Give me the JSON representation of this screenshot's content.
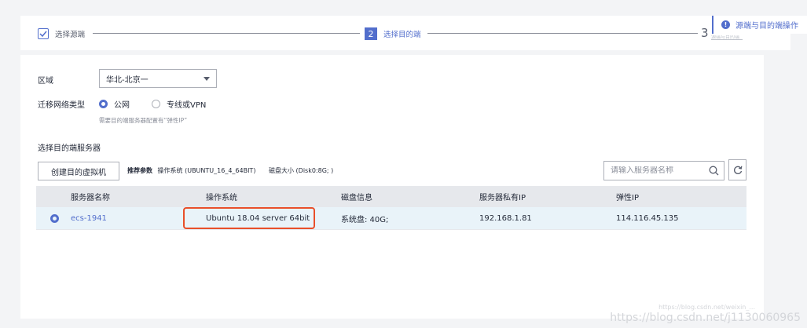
{
  "wizard": {
    "step1_label": "选择源端",
    "step2_number": "2",
    "step2_label": "选择目的端",
    "step3_number": "3",
    "step3_label_cut": "源端与目的端",
    "tip_text": "源端与目的端操作"
  },
  "form": {
    "region_label": "区域",
    "region_value": "华北-北京一",
    "network_label": "迁移网络类型",
    "network_options": [
      "公网",
      "专线或VPN"
    ],
    "network_selected": "公网",
    "network_hint": "需要目的端服务器配置有“弹性IP”",
    "target_server_label": "选择目的端服务器"
  },
  "toolbar": {
    "create_vm_label": "创建目的虚拟机",
    "recommend_label": "推荐参数",
    "recommend_os": "操作系统 (UBUNTU_16_4_64BIT)",
    "recommend_disk": "磁盘大小 (Disk0:8G; )",
    "search_placeholder": "请输入服务器名称"
  },
  "table": {
    "headers": [
      "服务器名称",
      "操作系统",
      "磁盘信息",
      "服务器私有IP",
      "弹性IP"
    ],
    "rows": [
      {
        "name": "ecs-1941",
        "os": "Ubuntu 18.04 server 64bit",
        "disk": "系统盘: 40G;",
        "private_ip": "192.168.1.81",
        "elastic_ip": "114.116.45.135"
      }
    ]
  },
  "watermark": {
    "small": "https://blog.csdn.net/weixin_...",
    "large": "https://blog.csdn.net/j1130060965"
  },
  "colors": {
    "accent": "#526ecc",
    "highlight": "#e94f2a",
    "row_selected": "#e9f3f9",
    "header_bg": "#e6e8ec"
  }
}
